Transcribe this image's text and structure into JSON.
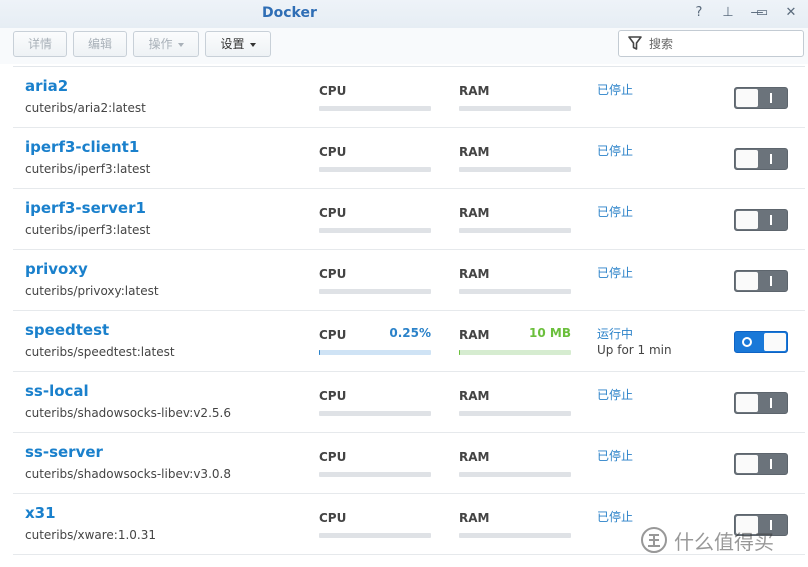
{
  "window": {
    "title": "Docker",
    "controls": [
      {
        "name": "help-icon",
        "glyph": "?"
      },
      {
        "name": "pin-icon",
        "glyph": "⊥"
      },
      {
        "name": "minimize-icon",
        "glyph": "—"
      },
      {
        "name": "maximize-icon",
        "glyph": "▭"
      },
      {
        "name": "close-icon",
        "glyph": "✕"
      }
    ]
  },
  "toolbar": {
    "details_label": "详情",
    "edit_label": "编辑",
    "action_label": "操作",
    "settings_label": "设置"
  },
  "search": {
    "placeholder": "搜索",
    "icon": "filter-icon"
  },
  "metric_labels": {
    "cpu": "CPU",
    "ram": "RAM"
  },
  "colors": {
    "name": "#1a80cc",
    "status": "#2b82c9",
    "cpu_value": "#2b82c9",
    "ram_value": "#6bbf3c",
    "toggle_on": "#1978d8",
    "toggle_off": "#6b737b"
  },
  "containers": [
    {
      "name": "aria2",
      "image": "cuteribs/aria2:latest",
      "status": "已停止",
      "uptime": "",
      "running": false,
      "cpu_value": "",
      "ram_value": "",
      "cpu_fraction": 0,
      "ram_fraction": 0
    },
    {
      "name": "iperf3-client1",
      "image": "cuteribs/iperf3:latest",
      "status": "已停止",
      "uptime": "",
      "running": false,
      "cpu_value": "",
      "ram_value": "",
      "cpu_fraction": 0,
      "ram_fraction": 0
    },
    {
      "name": "iperf3-server1",
      "image": "cuteribs/iperf3:latest",
      "status": "已停止",
      "uptime": "",
      "running": false,
      "cpu_value": "",
      "ram_value": "",
      "cpu_fraction": 0,
      "ram_fraction": 0
    },
    {
      "name": "privoxy",
      "image": "cuteribs/privoxy:latest",
      "status": "已停止",
      "uptime": "",
      "running": false,
      "cpu_value": "",
      "ram_value": "",
      "cpu_fraction": 0,
      "ram_fraction": 0
    },
    {
      "name": "speedtest",
      "image": "cuteribs/speedtest:latest",
      "status": "运行中",
      "uptime": "Up for 1 min",
      "running": true,
      "cpu_value": "0.25%",
      "ram_value": "10 MB",
      "cpu_fraction": 0.0025,
      "ram_fraction": 0.005
    },
    {
      "name": "ss-local",
      "image": "cuteribs/shadowsocks-libev:v2.5.6",
      "status": "已停止",
      "uptime": "",
      "running": false,
      "cpu_value": "",
      "ram_value": "",
      "cpu_fraction": 0,
      "ram_fraction": 0
    },
    {
      "name": "ss-server",
      "image": "cuteribs/shadowsocks-libev:v3.0.8",
      "status": "已停止",
      "uptime": "",
      "running": false,
      "cpu_value": "",
      "ram_value": "",
      "cpu_fraction": 0,
      "ram_fraction": 0
    },
    {
      "name": "x31",
      "image": "cuteribs/xware:1.0.31",
      "status": "已停止",
      "uptime": "",
      "running": false,
      "cpu_value": "",
      "ram_value": "",
      "cpu_fraction": 0,
      "ram_fraction": 0
    }
  ],
  "watermark": {
    "text": "什么值得买",
    "icon": "zhi-logo"
  }
}
